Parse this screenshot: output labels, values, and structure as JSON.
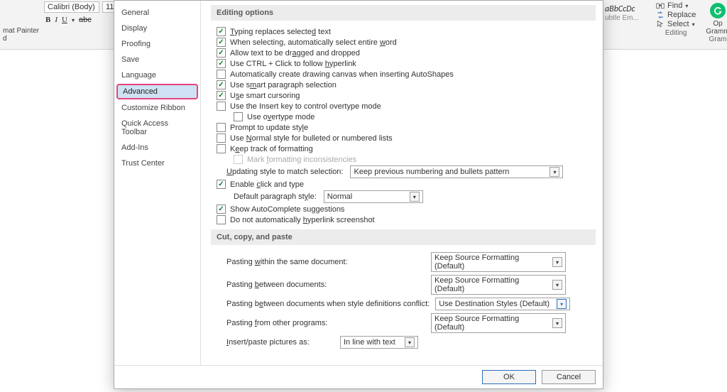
{
  "ribbon": {
    "font_name": "Calibri (Body)",
    "font_size": "11",
    "format_painter": "mat Painter",
    "clipboard_suffix": "d",
    "style_sample1": "aBbCcDc",
    "style_more": "ubtle Em...",
    "find": "Find",
    "replace": "Replace",
    "select": "Select",
    "editing_label": "Editing",
    "open_partial": "Op",
    "gram_partial": "Gramm",
    "gram_group": "Gram"
  },
  "nav": {
    "items": [
      "General",
      "Display",
      "Proofing",
      "Save",
      "Language",
      "Advanced",
      "Customize Ribbon",
      "Quick Access Toolbar",
      "Add-Ins",
      "Trust Center"
    ]
  },
  "section1": "Editing options",
  "opts": {
    "typing_replaces": "Typing replaces selected text",
    "select_word": "When selecting, automatically select entire word",
    "drag_drop": "Allow text to be dragged and dropped",
    "ctrl_click": "Use CTRL + Click to follow hyperlink",
    "auto_canvas": "Automatically create drawing canvas when inserting AutoShapes",
    "smart_para": "Use smart paragraph selection",
    "smart_cursor": "Use smart cursoring",
    "insert_key": "Use the Insert key to control overtype mode",
    "overtype_mode": "Use overtype mode",
    "prompt_update": "Prompt to update style",
    "normal_bullets": "Use Normal style for bulleted or numbered lists",
    "keep_track": "Keep track of formatting",
    "mark_inconsist": "Mark formatting inconsistencies",
    "updating_style_label": "Updating style to match selection:",
    "updating_style_value": "Keep previous numbering and bullets pattern",
    "enable_click_type": "Enable click and type",
    "default_para_label": "Default paragraph style:",
    "default_para_value": "Normal",
    "show_autocomplete": "Show AutoComplete suggestions",
    "no_auto_hyperlink": "Do not automatically hyperlink screenshot"
  },
  "section2": "Cut, copy, and paste",
  "paste": {
    "within_label": "Pasting within the same document:",
    "within_value": "Keep Source Formatting (Default)",
    "between_label": "Pasting between documents:",
    "between_value": "Keep Source Formatting (Default)",
    "conflict_label": "Pasting between documents when style definitions conflict:",
    "conflict_value": "Use Destination Styles (Default)",
    "other_label": "Pasting from other programs:",
    "other_value": "Keep Source Formatting (Default)",
    "insert_pic_label": "Insert/paste pictures as:",
    "insert_pic_value": "In line with text"
  },
  "footer": {
    "ok": "OK",
    "cancel": "Cancel"
  }
}
